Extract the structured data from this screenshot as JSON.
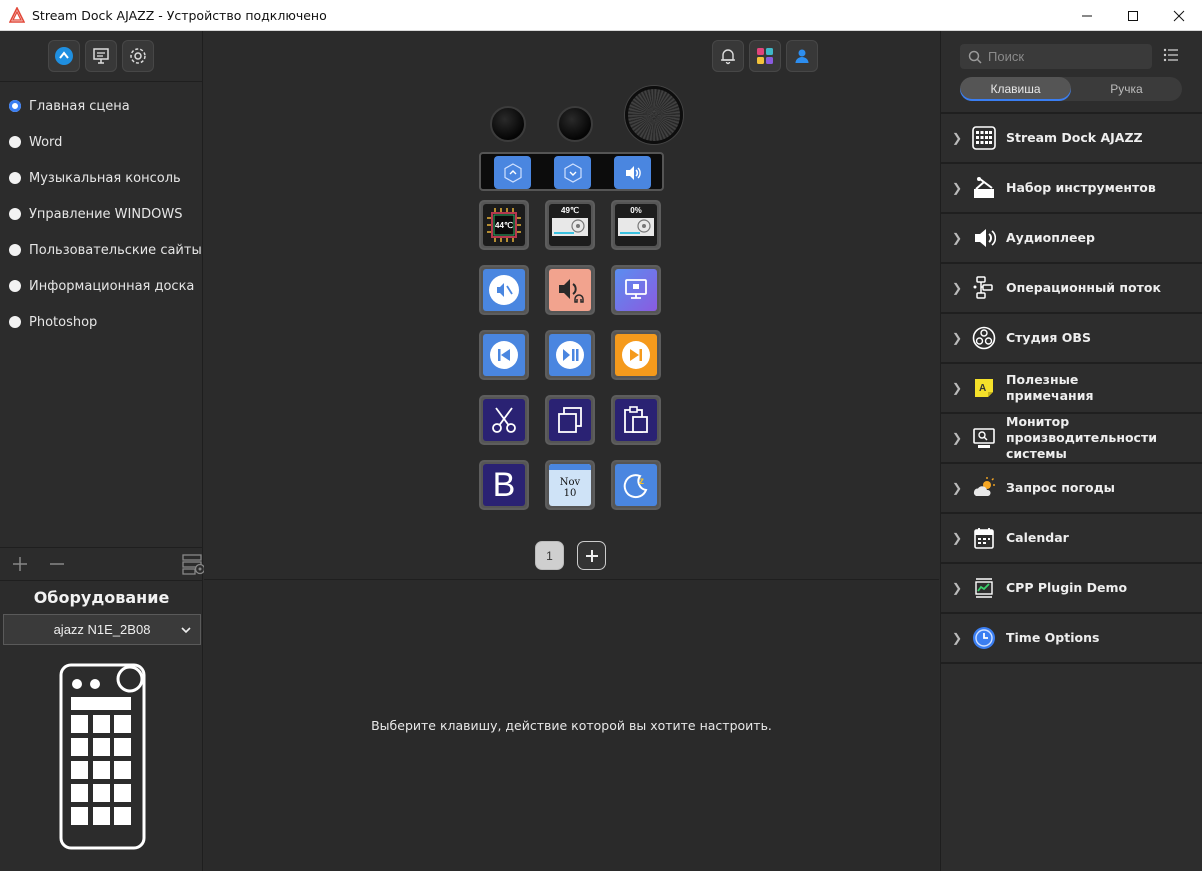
{
  "window": {
    "title": "Stream Dock AJAZZ - Устройство подключено"
  },
  "scenes": [
    {
      "label": "Главная сцена",
      "selected": true
    },
    {
      "label": "Word",
      "selected": false
    },
    {
      "label": "Музыкальная консоль",
      "selected": false
    },
    {
      "label": "Управление WINDOWS",
      "selected": false
    },
    {
      "label": "Пользовательские сайты",
      "selected": false
    },
    {
      "label": "Информационная доска",
      "selected": false
    },
    {
      "label": "Photoshop",
      "selected": false
    }
  ],
  "hardware": {
    "title": "Оборудование",
    "device": "ajazz N1E_2B08"
  },
  "keys": {
    "cpu_temp": "44℃",
    "gpu_temp": "49℃",
    "gpu_load": "0%",
    "calendar_month": "Nov",
    "calendar_day": "10",
    "bold_letter": "B"
  },
  "pages": {
    "current": "1"
  },
  "hint": "Выберите клавишу, действие которой вы хотите настроить.",
  "search": {
    "placeholder": "Поиск"
  },
  "tabs": [
    {
      "label": "Клавиша",
      "active": true
    },
    {
      "label": "Ручка",
      "active": false
    }
  ],
  "categories": [
    {
      "label": "Stream Dock AJAZZ",
      "icon": "keyboard-icon"
    },
    {
      "label": "Набор инструментов",
      "icon": "toolbox-icon"
    },
    {
      "label": "Аудиоплеер",
      "icon": "speaker-icon"
    },
    {
      "label": "Операционный поток",
      "icon": "workflow-icon"
    },
    {
      "label": "Студия OBS",
      "icon": "obs-icon"
    },
    {
      "label": "Полезные примечания",
      "icon": "sticky-note-icon"
    },
    {
      "label": "Монитор производительности системы",
      "icon": "monitor-icon"
    },
    {
      "label": "Запрос погоды",
      "icon": "weather-icon"
    },
    {
      "label": "Calendar",
      "icon": "calendar-icon"
    },
    {
      "label": "CPP Plugin Demo",
      "icon": "plugin-icon"
    },
    {
      "label": "Time Options",
      "icon": "clock-icon"
    }
  ],
  "colors": {
    "accent": "#3a7ef2",
    "background": "#2b2b2b",
    "key_blue": "#4a86e0",
    "key_salmon": "#f2a38e",
    "key_orange": "#f59a1c",
    "key_navy": "#2a2273"
  }
}
